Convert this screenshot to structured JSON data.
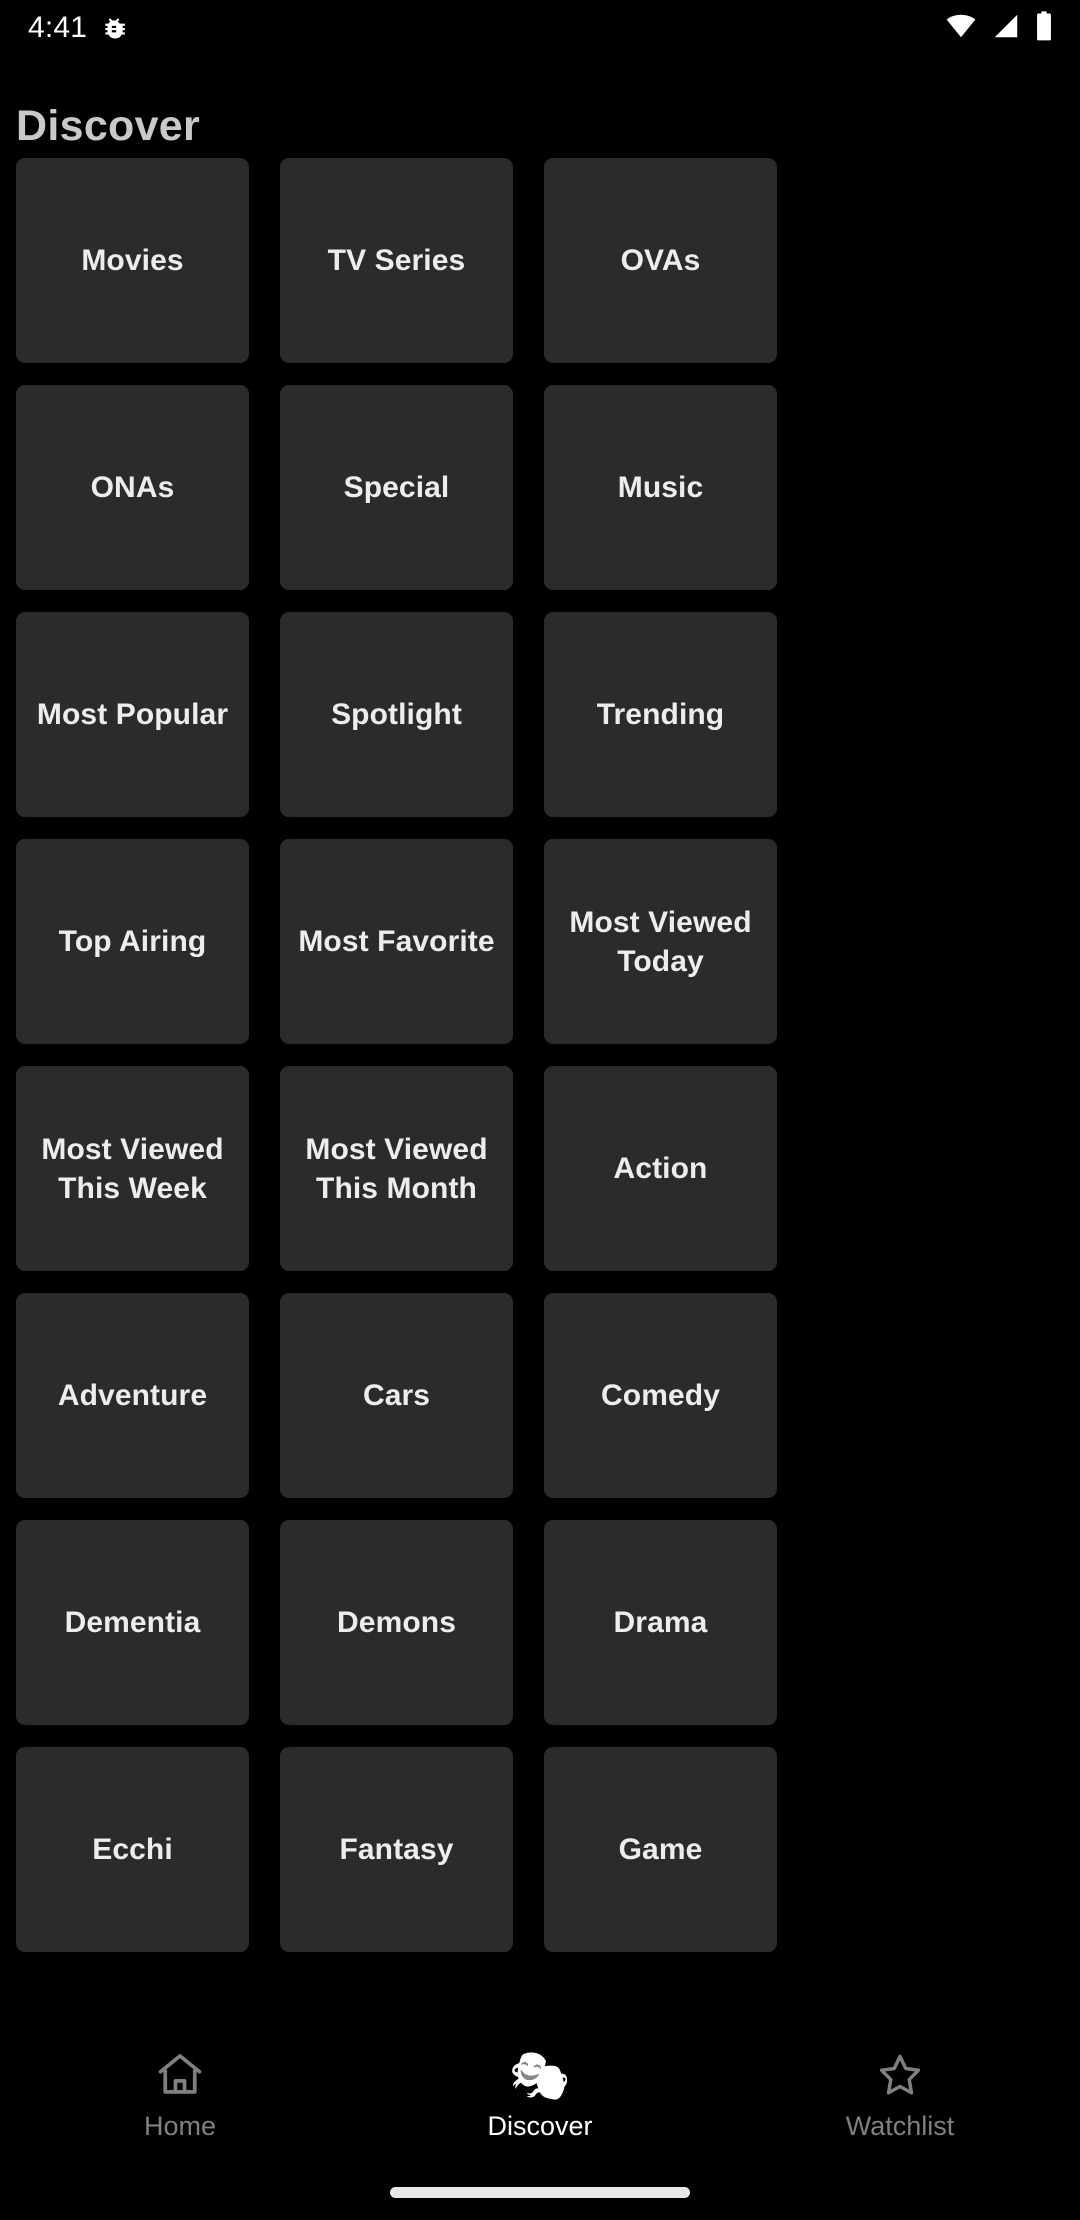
{
  "status_bar": {
    "time": "4:41",
    "left_icons": [
      "bug-icon"
    ],
    "right_icons": [
      "wifi-icon",
      "cellular-signal-icon",
      "battery-icon"
    ]
  },
  "header": {
    "title": "Discover"
  },
  "grid": {
    "columns": 3,
    "tiles": [
      {
        "label": "Movies"
      },
      {
        "label": "TV Series"
      },
      {
        "label": "OVAs"
      },
      {
        "label": "ONAs"
      },
      {
        "label": "Special"
      },
      {
        "label": "Music"
      },
      {
        "label": "Most Popular"
      },
      {
        "label": "Spotlight"
      },
      {
        "label": "Trending"
      },
      {
        "label": "Top Airing"
      },
      {
        "label": "Most Favorite"
      },
      {
        "label": "Most Viewed Today"
      },
      {
        "label": "Most Viewed This Week"
      },
      {
        "label": "Most Viewed This Month"
      },
      {
        "label": "Action"
      },
      {
        "label": "Adventure"
      },
      {
        "label": "Cars"
      },
      {
        "label": "Comedy"
      },
      {
        "label": "Dementia"
      },
      {
        "label": "Demons"
      },
      {
        "label": "Drama"
      },
      {
        "label": "Ecchi"
      },
      {
        "label": "Fantasy"
      },
      {
        "label": "Game"
      }
    ]
  },
  "bottom_nav": {
    "items": [
      {
        "label": "Home",
        "icon": "home-icon",
        "active": false
      },
      {
        "label": "Discover",
        "icon": "theater-masks-icon",
        "active": true
      },
      {
        "label": "Watchlist",
        "icon": "star-icon",
        "active": false
      }
    ]
  },
  "colors": {
    "background": "#000000",
    "tile": "#2b2b2b",
    "tile_text": "#ededed",
    "title_text": "#c9c9c9",
    "nav_active": "#ffffff",
    "nav_inactive": "#808080"
  }
}
